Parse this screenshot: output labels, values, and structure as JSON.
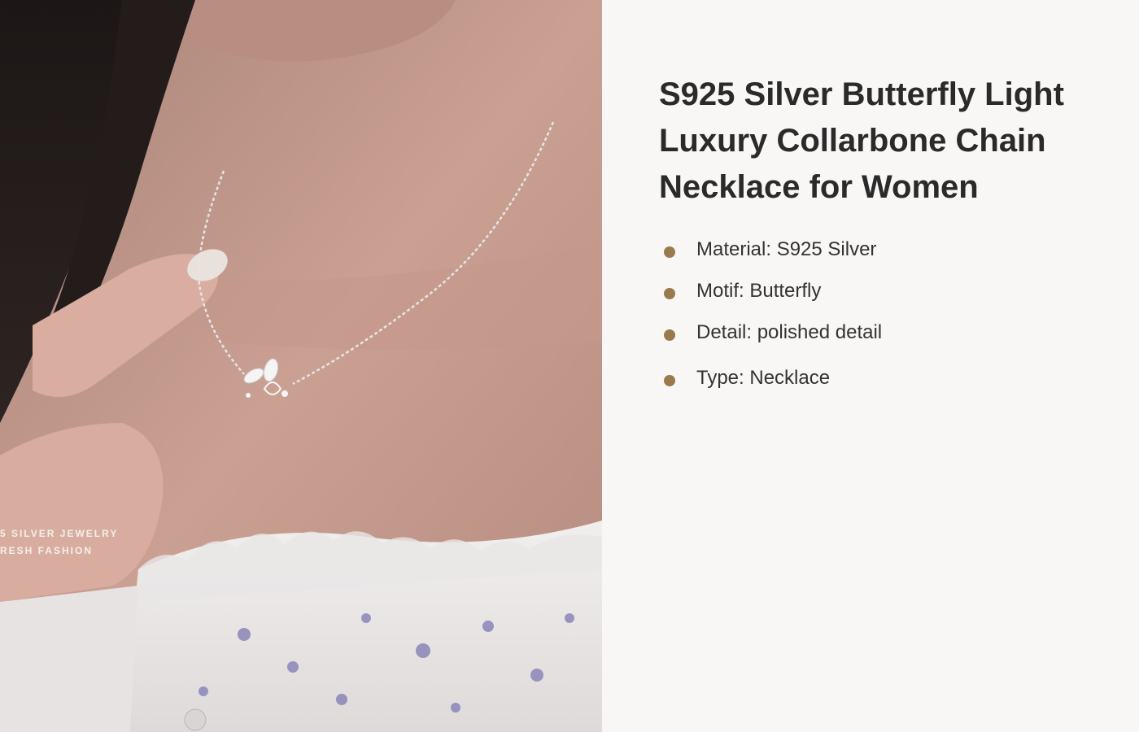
{
  "photo": {
    "overlay_line_1": "5 SILVER JEWELRY",
    "overlay_line_2": "RESH FASHION"
  },
  "product": {
    "title": "S925 Silver Butterfly Light Luxury Collarbone Chain Necklace for Women"
  },
  "specs": [
    {
      "text": "Material: S925 Silver"
    },
    {
      "text": "Motif: Butterfly"
    },
    {
      "text": "Detail: polished detail"
    },
    {
      "text": "Type: Necklace"
    }
  ],
  "colors": {
    "bullet": "#9a7a4c",
    "title": "#2a2a2a",
    "background": "#f8f7f5"
  }
}
